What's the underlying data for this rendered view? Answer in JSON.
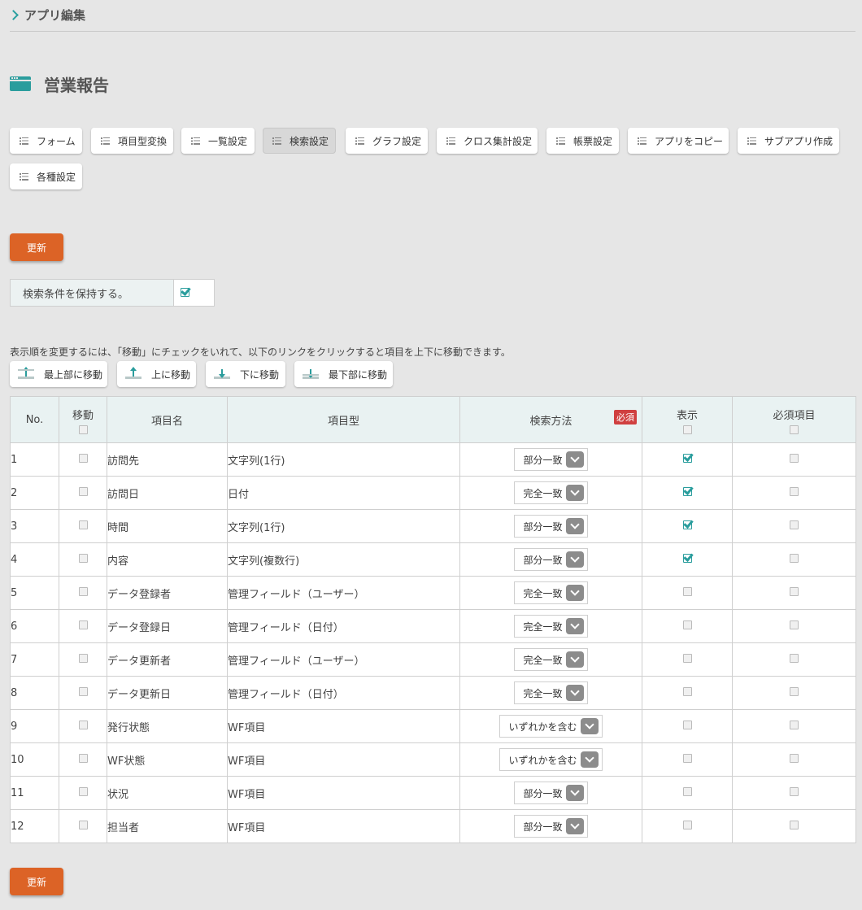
{
  "breadcrumb": "アプリ編集",
  "app": {
    "title": "営業報告"
  },
  "tabs": [
    {
      "label": "フォーム",
      "active": false
    },
    {
      "label": "項目型変換",
      "active": false
    },
    {
      "label": "一覧設定",
      "active": false
    },
    {
      "label": "検索設定",
      "active": true
    },
    {
      "label": "グラフ設定",
      "active": false
    },
    {
      "label": "クロス集計設定",
      "active": false
    },
    {
      "label": "帳票設定",
      "active": false
    },
    {
      "label": "アプリをコピー",
      "active": false
    },
    {
      "label": "サブアプリ作成",
      "active": false
    },
    {
      "label": "各種設定",
      "active": false
    }
  ],
  "update_label": "更新",
  "keep_condition": {
    "label": "検索条件を保持する。",
    "checked": true
  },
  "hint": "表示順を変更するには、「移動」にチェックをいれて、以下のリンクをクリックすると項目を上下に移動できます。",
  "move_buttons": {
    "top": "最上部に移動",
    "up": "上に移動",
    "down": "下に移動",
    "bottom": "最下部に移動"
  },
  "table": {
    "headers": {
      "no": "No.",
      "move": "移動",
      "name": "項目名",
      "type": "項目型",
      "method": "検索方法",
      "required_badge": "必須",
      "display": "表示",
      "required_item": "必須項目"
    },
    "rows": [
      {
        "no": "1",
        "name": "訪問先",
        "type": "文字列(1行)",
        "method": "部分一致",
        "display": true,
        "required": false
      },
      {
        "no": "2",
        "name": "訪問日",
        "type": "日付",
        "method": "完全一致",
        "display": true,
        "required": false
      },
      {
        "no": "3",
        "name": "時間",
        "type": "文字列(1行)",
        "method": "部分一致",
        "display": true,
        "required": false
      },
      {
        "no": "4",
        "name": "内容",
        "type": "文字列(複数行)",
        "method": "部分一致",
        "display": true,
        "required": false
      },
      {
        "no": "5",
        "name": "データ登録者",
        "type": "管理フィールド（ユーザー）",
        "method": "完全一致",
        "display": false,
        "required": false
      },
      {
        "no": "6",
        "name": "データ登録日",
        "type": "管理フィールド（日付）",
        "method": "完全一致",
        "display": false,
        "required": false
      },
      {
        "no": "7",
        "name": "データ更新者",
        "type": "管理フィールド（ユーザー）",
        "method": "完全一致",
        "display": false,
        "required": false
      },
      {
        "no": "8",
        "name": "データ更新日",
        "type": "管理フィールド（日付）",
        "method": "完全一致",
        "display": false,
        "required": false
      },
      {
        "no": "9",
        "name": "発行状態",
        "type": "WF項目",
        "method": "いずれかを含む",
        "display": false,
        "required": false
      },
      {
        "no": "10",
        "name": "WF状態",
        "type": "WF項目",
        "method": "いずれかを含む",
        "display": false,
        "required": false
      },
      {
        "no": "11",
        "name": "状況",
        "type": "WF項目",
        "method": "部分一致",
        "display": false,
        "required": false
      },
      {
        "no": "12",
        "name": "担当者",
        "type": "WF項目",
        "method": "部分一致",
        "display": false,
        "required": false
      }
    ]
  }
}
